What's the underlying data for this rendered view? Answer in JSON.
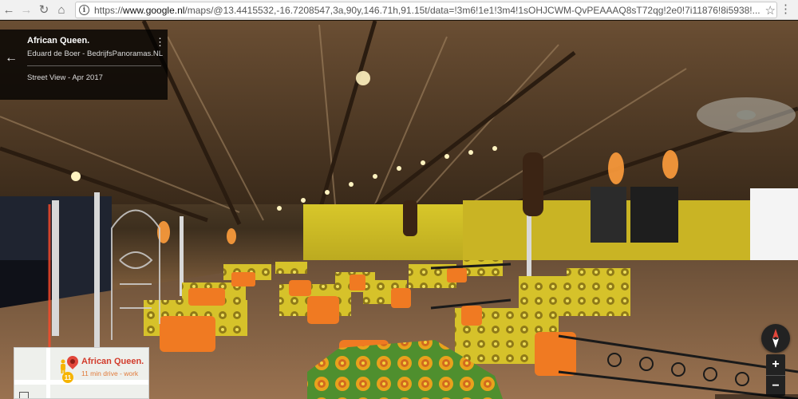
{
  "browser": {
    "url_prefix": "https://",
    "url_domain": "www.google.nl",
    "url_rest": "/maps/@13.4415532,-16.7208547,3a,90y,146.71h,91.15t/data=!3m6!1e1!3m4!1sOHJCWM-QvPEAAAQ8sT72qg!2e0!7i11876!8i5938!...",
    "icons": [
      "back-arrow-icon",
      "forward-arrow-icon",
      "reload-icon",
      "info-icon",
      "star-icon",
      "menu-icon"
    ]
  },
  "info_card": {
    "title": "African Queen.",
    "author": "Eduard de Boer - BedrijfsPanoramas.NL",
    "date_label": "Street View - Apr 2017"
  },
  "minimap": {
    "place_name": "African Queen.",
    "drive_info": "11 min drive - work",
    "badge": "11",
    "colors": {
      "pin": "#e2473b",
      "place": "#d23c2c",
      "drive": "#e07a3a"
    }
  },
  "controls": {
    "zoom_in": "+",
    "zoom_out": "−"
  },
  "colors": {
    "accent": "#e2473b",
    "card_bg": "#000000"
  }
}
